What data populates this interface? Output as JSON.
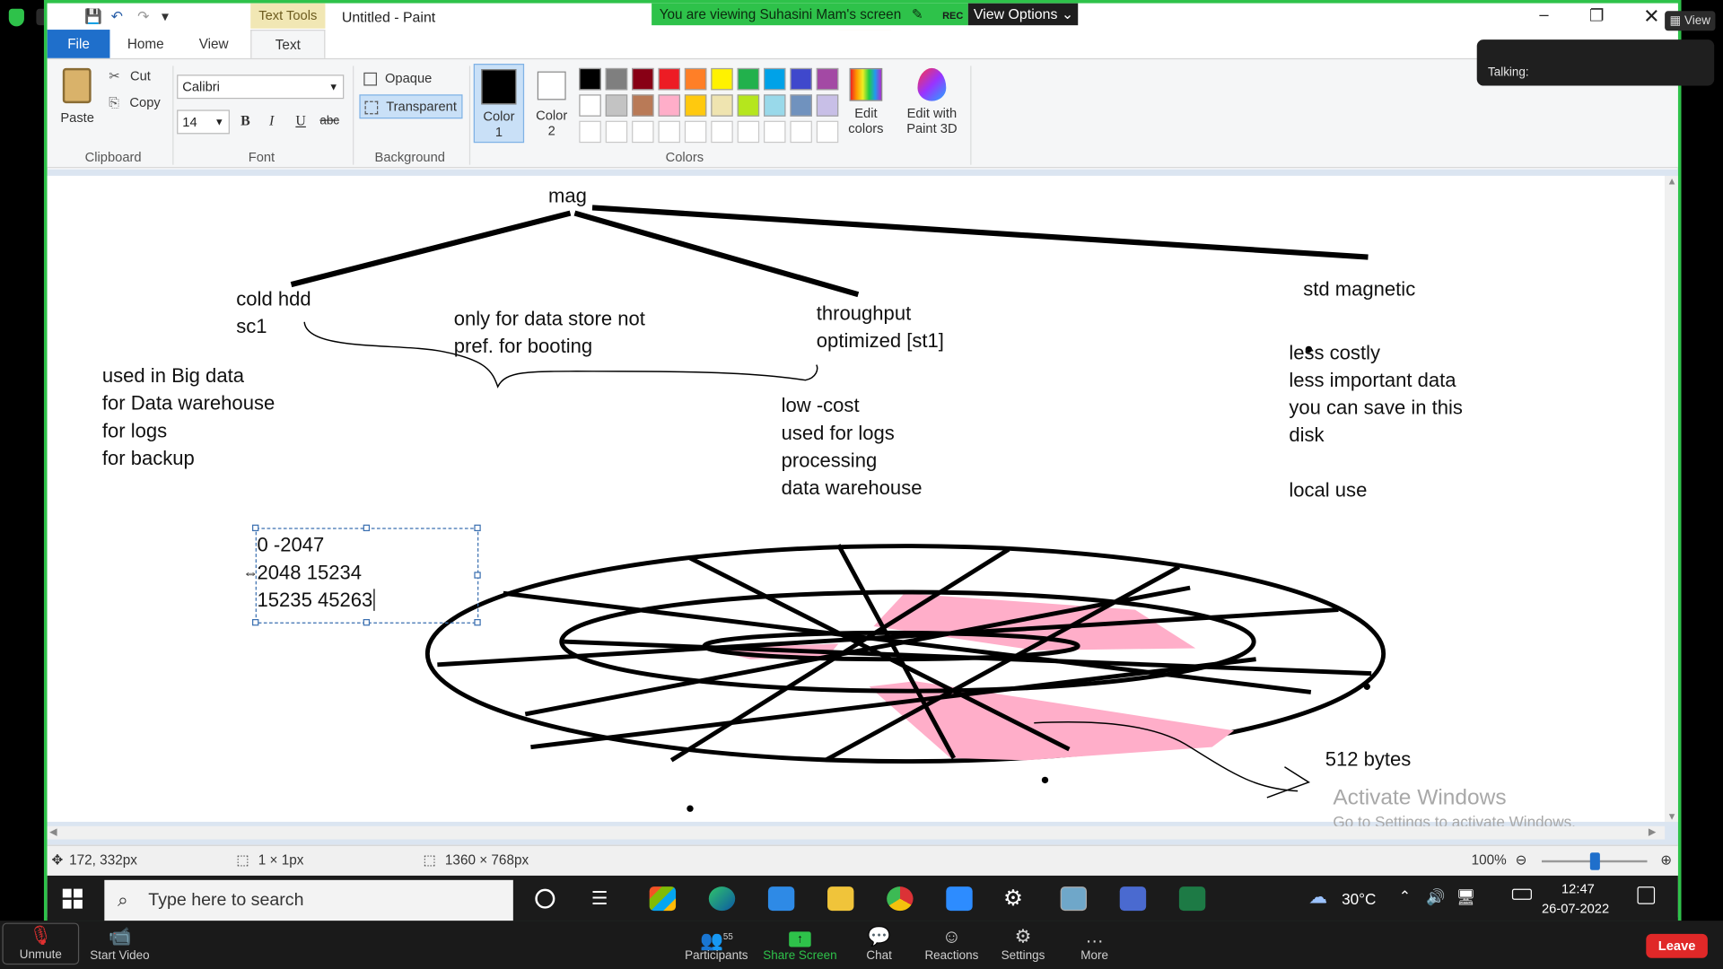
{
  "titlebar": {
    "text_tools": "Text Tools",
    "window_title": "Untitled - Paint",
    "share_banner": "You are viewing Suhasini Mam's screen",
    "rec_label": "REC",
    "view_options": "View Options"
  },
  "zoom_overlay": {
    "rec": "REC",
    "view_label": "View",
    "talking_label": "Talking:"
  },
  "ribbon": {
    "tabs": [
      "File",
      "Home",
      "View",
      "Text"
    ],
    "clipboard": {
      "paste": "Paste",
      "cut": "Cut",
      "copy": "Copy",
      "label": "Clipboard"
    },
    "font": {
      "family": "Calibri",
      "size": "14",
      "bold": "B",
      "italic": "I",
      "underline": "U",
      "strike": "abc",
      "label": "Font"
    },
    "background": {
      "opaque": "Opaque",
      "transparent": "Transparent",
      "label": "Background"
    },
    "colors": {
      "color1": "Color 1",
      "color2": "Color 2",
      "label": "Colors",
      "edit_colors": "Edit colors",
      "edit_paint3d": "Edit with Paint 3D",
      "row1": [
        "#000000",
        "#7f7f7f",
        "#880015",
        "#ed1c24",
        "#ff7f27",
        "#fff200",
        "#22b14c",
        "#00a2e8",
        "#3f48cc",
        "#a349a4"
      ],
      "row2": [
        "#ffffff",
        "#c3c3c3",
        "#b97a57",
        "#ffaec9",
        "#ffc90e",
        "#efe4b0",
        "#b5e61d",
        "#99d9ea",
        "#7092be",
        "#c8bfe7"
      ]
    }
  },
  "drawing": {
    "mag": "mag",
    "cold_hdd": [
      "cold  hdd",
      "sc1"
    ],
    "only_for_data": [
      "only for data store not",
      "pref.  for booting"
    ],
    "throughput": [
      "throughput",
      "optimized [st1]"
    ],
    "std_magnetic": "std  magnetic",
    "used_in_big_data": [
      "used in Big data",
      "for Data  warehouse",
      "for logs",
      "for backup"
    ],
    "low_cost": [
      "low -cost",
      "used for logs",
      "processing",
      "data warehouse"
    ],
    "less_costly": [
      "less costly",
      "less important data",
      "you can save in this",
      "disk",
      "",
      "local use"
    ],
    "sector_ranges": [
      "0 -2047",
      "2048   15234",
      "15235   45263"
    ],
    "bytes": "512  bytes",
    "watermark_title": "Activate Windows",
    "watermark_sub": "Go to Settings to activate Windows."
  },
  "statusbar": {
    "cursor_pos": "172, 332px",
    "selection_size": "1 × 1px",
    "canvas_size": "1360 × 768px",
    "zoom": "100%"
  },
  "taskbar": {
    "search_placeholder": "Type here to search",
    "weather": "30°C",
    "time": "12:47",
    "date": "26-07-2022"
  },
  "meeting": {
    "unmute": "Unmute",
    "start_video": "Start Video",
    "participants": "Participants",
    "participants_count": "55",
    "share_screen": "Share Screen",
    "chat": "Chat",
    "reactions": "Reactions",
    "settings": "Settings",
    "more": "More",
    "leave": "Leave"
  }
}
